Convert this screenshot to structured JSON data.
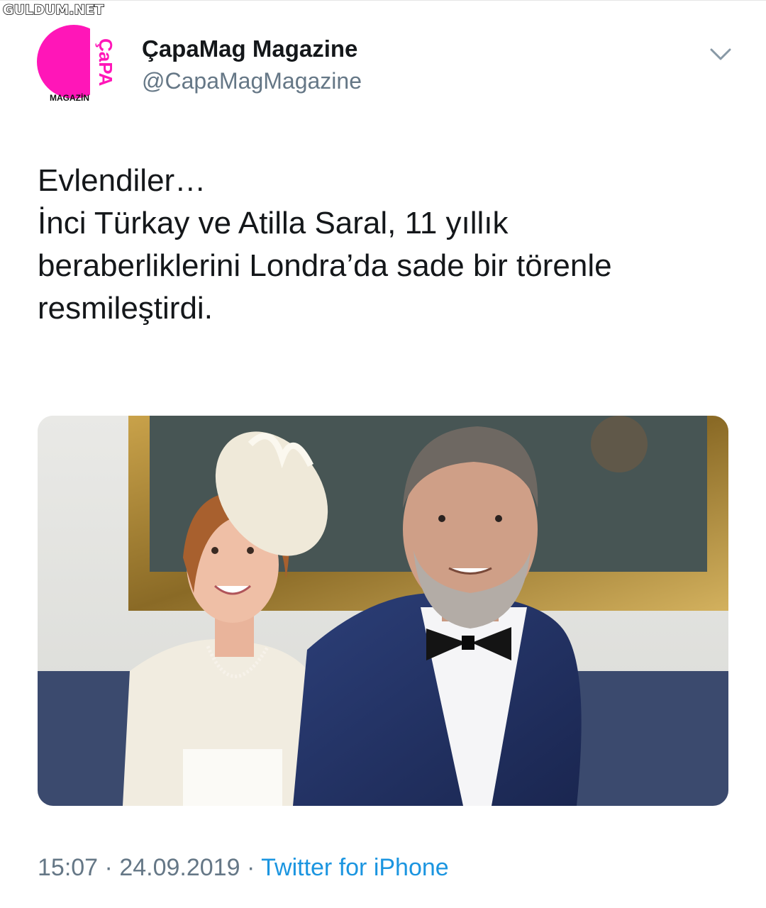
{
  "watermark": "GULDUM.NET",
  "tweet": {
    "author": {
      "display_name": "ÇapaMag Magazine",
      "handle": "@CapaMagMagazine",
      "avatar_text_main": "ÇaPA",
      "avatar_text_sub": "MAGAZİN",
      "avatar_color": "#ff16b8"
    },
    "text_lines": [
      "Evlendiler…",
      "İnci Türkay ve Atilla Saral, 11 yıllık",
      "beraberliklerini Londra’da sade bir törenle",
      "resmileştirdi."
    ],
    "media": {
      "description_icon": "photo"
    },
    "time": "15:07",
    "separator": "·",
    "date": "24.09.2019",
    "source": "Twitter for iPhone",
    "menu_icon": "chevron-down-icon"
  }
}
